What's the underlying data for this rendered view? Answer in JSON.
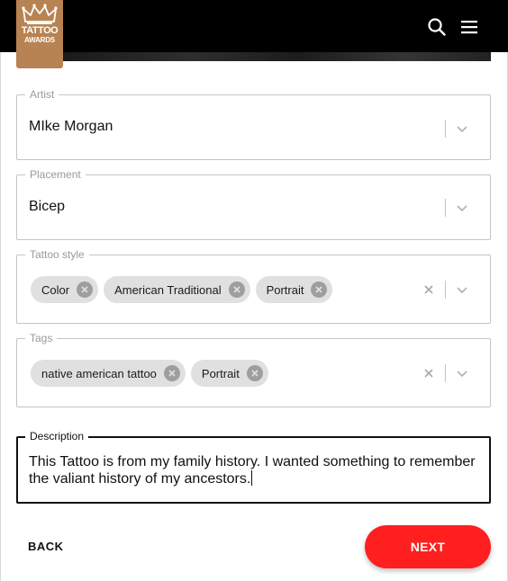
{
  "brand": {
    "logo_line1": "TATTOO",
    "logo_line2": "AWARDS",
    "color": "#b88352"
  },
  "header": {
    "icons": [
      "search-icon",
      "menu-icon"
    ]
  },
  "form": {
    "artist": {
      "label": "Artist",
      "value": "MIke Morgan"
    },
    "placement": {
      "label": "Placement",
      "value": "Bicep"
    },
    "tattoo_style": {
      "label": "Tattoo style",
      "chips": [
        "Color",
        "American Traditional",
        "Portrait"
      ]
    },
    "tags": {
      "label": "Tags",
      "chips": [
        "native american tattoo",
        "Portrait"
      ]
    },
    "description": {
      "label": "Description",
      "value": "This Tattoo is from my family history. I wanted something to remember the valiant history of my ancestors."
    }
  },
  "footer": {
    "back_label": "BACK",
    "next_label": "NEXT",
    "next_color": "#ff1f1f"
  }
}
